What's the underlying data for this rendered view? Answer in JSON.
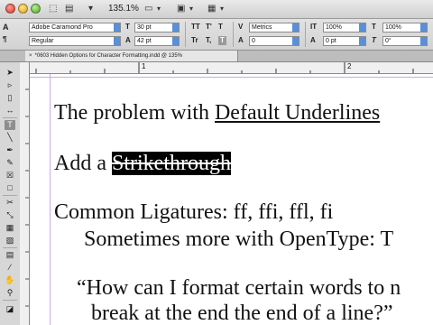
{
  "app": {
    "zoom": "135.1%"
  },
  "control_panel": {
    "font_family": "Adobe Caramond Pro",
    "font_style": "Regular",
    "font_size": "30 pt",
    "leading": "42 pt",
    "kerning": "Metrics",
    "tracking": "0",
    "vertical_scale": "100%",
    "horizontal_scale": "100%",
    "baseline_shift": "0 pt",
    "skew": "0°",
    "tt_label": "TT",
    "t1_label": "T'",
    "t2_label": "T",
    "tr_label": "Tr",
    "t_sub_label": "T,",
    "t_under_label": "T",
    "t_strike_label": "T"
  },
  "document": {
    "tab_title": "*0603 Hidden Options for Character Formatting.indd @ 135%",
    "ruler_marks": [
      "1",
      "2"
    ],
    "lines": [
      {
        "prefix": "The problem with ",
        "styled": "Default Underlines"
      },
      {
        "prefix": "Add a ",
        "styled": "Strikethrough"
      },
      {
        "text": "Common Ligatures: ff, ffi, ffl, fi"
      },
      {
        "text": "Sometimes more with OpenType: T"
      },
      {
        "text": "“How can I format certain words to n"
      },
      {
        "text": "break at the end the end of a line?”"
      }
    ]
  }
}
